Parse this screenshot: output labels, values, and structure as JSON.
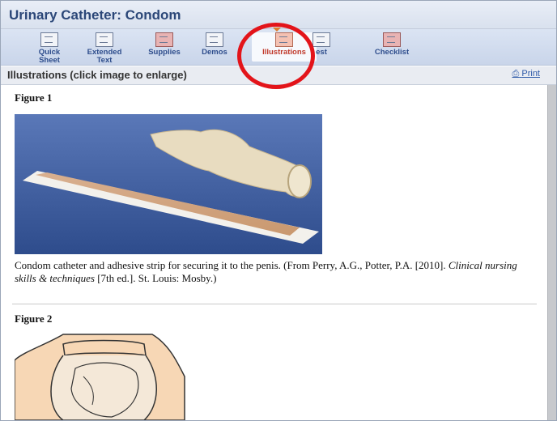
{
  "window": {
    "title": "Urinary Catheter: Condom"
  },
  "toolbar": {
    "items": [
      {
        "label_line1": "Quick",
        "label_line2": "Sheet",
        "icon": "document-icon"
      },
      {
        "label_line1": "Extended",
        "label_line2": "Text",
        "icon": "text-document-icon"
      },
      {
        "label_line1": "Supplies",
        "label_line2": "",
        "icon": "supplies-icon"
      },
      {
        "label_line1": "Demos",
        "label_line2": "",
        "icon": "video-icon"
      },
      {
        "label_line1": "Illustrations",
        "label_line2": "",
        "icon": "illustration-icon",
        "active": true
      },
      {
        "label_line1": "Test",
        "label_line2": "",
        "visible_text": "est",
        "icon": "test-icon"
      },
      {
        "label_line1": "Checklist",
        "label_line2": "",
        "icon": "checklist-icon"
      }
    ]
  },
  "section": {
    "heading": "Illustrations (click image to enlarge)",
    "print_label": "Print"
  },
  "figures": [
    {
      "title": "Figure 1",
      "caption_part1": "Condom catheter and adhesive strip for securing it to the penis. (From Perry, A.G., Potter, P.A. [2010]. ",
      "caption_italic": "Clinical nursing skills & techniques",
      "caption_part2": " [7th ed.]. St. Louis: Mosby.)"
    },
    {
      "title": "Figure 2"
    }
  ],
  "colors": {
    "title_text": "#2b4778",
    "toolbar_bg": "#c9d5ea",
    "active_tab_text": "#c0392b",
    "annotation_circle": "#e3141a",
    "photo_background": "#3f5fa0"
  }
}
